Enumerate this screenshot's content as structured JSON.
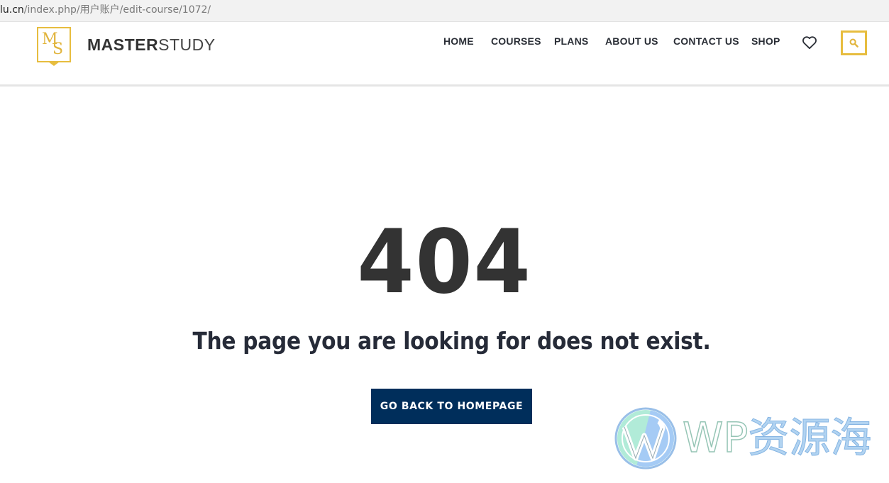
{
  "browser": {
    "url_host": "lu.cn",
    "url_path": "/index.php/用户账户/edit-course/1072/"
  },
  "header": {
    "logo": {
      "badge_m": "M",
      "badge_s": "S",
      "brand_bold": "MASTER",
      "brand_light": "STUDY"
    },
    "nav": [
      {
        "label": "HOME"
      },
      {
        "label": "COURSES"
      },
      {
        "label": "PLANS"
      },
      {
        "label": "ABOUT US"
      },
      {
        "label": "CONTACT US"
      },
      {
        "label": "SHOP"
      }
    ],
    "icons": {
      "wishlist": "heart-icon",
      "search": "search-icon"
    }
  },
  "main": {
    "error_code": "404",
    "message": "The page you are looking for does not exist.",
    "home_button": "GO BACK TO HOMEPAGE"
  },
  "watermark": {
    "logo_icon": "wordpress-logo-icon",
    "text_latin": "WP",
    "text_cn": "资源海"
  },
  "colors": {
    "accent_gold": "#e7bd3f",
    "button_navy": "#002e5b",
    "heading_dark": "#333333"
  }
}
